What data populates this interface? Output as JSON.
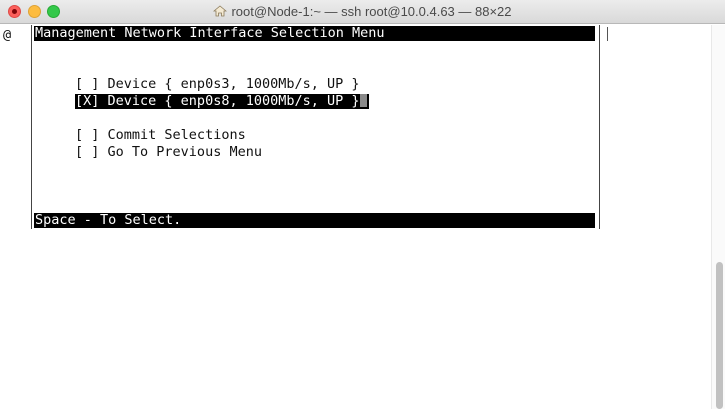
{
  "window": {
    "title": "root@Node-1:~ — ssh root@10.0.4.63 — 88×22"
  },
  "terminal": {
    "prompt_char": "@",
    "menu_title": "Management Network Interface Selection Menu",
    "items": [
      {
        "checkbox": "[ ]",
        "label": "Device { enp0s3, 1000Mb/s, UP }",
        "checked": false,
        "selected": false
      },
      {
        "checkbox": "[X]",
        "label": "Device { enp0s8, 1000Mb/s, UP }",
        "checked": true,
        "selected": true
      }
    ],
    "actions": [
      {
        "checkbox": "[ ]",
        "label": "Commit Selections"
      },
      {
        "checkbox": "[ ]",
        "label": "Go To Previous Menu"
      }
    ],
    "status": "Space - To Select."
  },
  "colors": {
    "close": "#fc605c",
    "minimize": "#fdbc40",
    "maximize": "#34c84a",
    "highlight": "#000000"
  }
}
